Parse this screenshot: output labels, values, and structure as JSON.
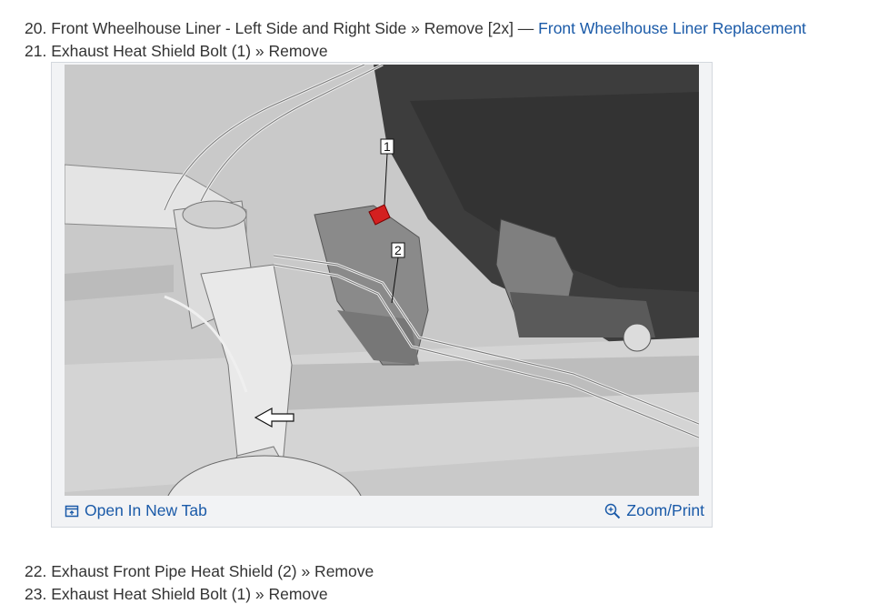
{
  "steps": {
    "s20": {
      "text": "20. Front Wheelhouse Liner - Left Side and Right Side » Remove [2x] — ",
      "link": "Front Wheelhouse Liner Replacement"
    },
    "s21": {
      "text": "21. Exhaust Heat Shield Bolt (1) » Remove"
    },
    "s22": {
      "text": "22. Exhaust Front Pipe Heat Shield (2) » Remove"
    },
    "s23": {
      "text": "23. Exhaust Heat Shield Bolt (1) » Remove"
    }
  },
  "figure": {
    "callouts": [
      "1",
      "2"
    ],
    "open_tab_label": "Open In New Tab",
    "zoom_label": "Zoom/Print",
    "open_tab_icon": "open-new-tab-icon",
    "zoom_icon": "zoom-magnifier-icon"
  },
  "colors": {
    "link": "#1a5aa8",
    "highlight_bolt": "#d42020"
  }
}
